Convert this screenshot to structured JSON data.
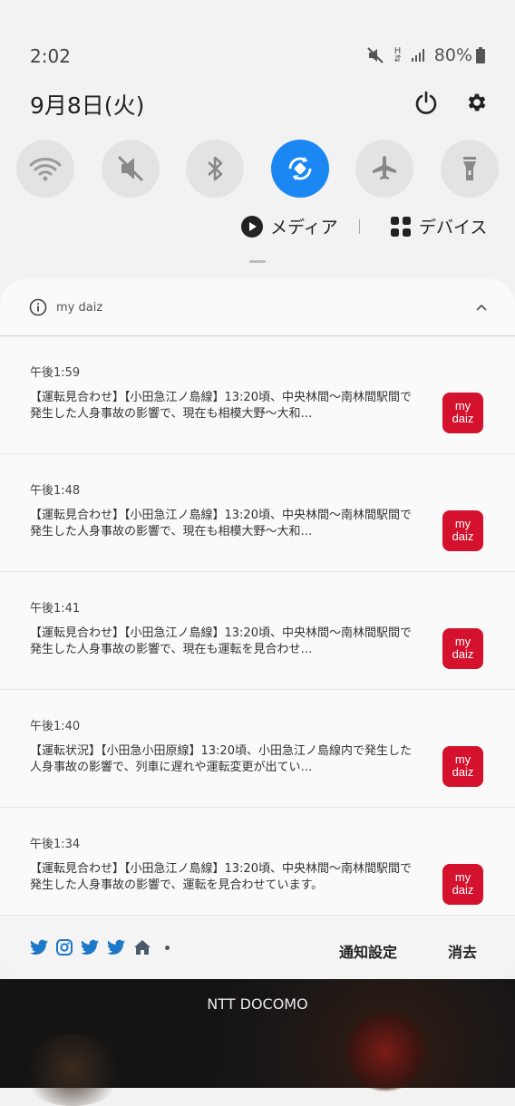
{
  "status_bar": {
    "time": "2:02",
    "battery": "80%",
    "network": "H"
  },
  "header": {
    "date": "9月8日(火)",
    "power_icon": "power-icon",
    "settings_icon": "gear-icon"
  },
  "quick_tiles": [
    {
      "icon": "wifi-icon",
      "active": false
    },
    {
      "icon": "sound-mute-icon",
      "active": false
    },
    {
      "icon": "bluetooth-icon",
      "active": false
    },
    {
      "icon": "auto-rotate-icon",
      "active": true
    },
    {
      "icon": "airplane-icon",
      "active": false
    },
    {
      "icon": "flashlight-icon",
      "active": false
    }
  ],
  "media": {
    "media_label": "メディア",
    "device_label": "デバイス"
  },
  "app_group": {
    "name": "my daiz"
  },
  "notifications": [
    {
      "time": "午後1:59",
      "text": "【運転見合わせ】【小田急江ノ島線】13:20頃、中央林間〜南林間駅間で発生した人身事故の影響で、現在も相模大野〜大和…",
      "logo_line1": "my",
      "logo_line2": "daiz"
    },
    {
      "time": "午後1:48",
      "text": "【運転見合わせ】【小田急江ノ島線】13:20頃、中央林間〜南林間駅間で発生した人身事故の影響で、現在も相模大野〜大和…",
      "logo_line1": "my",
      "logo_line2": "daiz"
    },
    {
      "time": "午後1:41",
      "text": "【運転見合わせ】【小田急江ノ島線】13:20頃、中央林間〜南林間駅間で発生した人身事故の影響で、現在も運転を見合わせ…",
      "logo_line1": "my",
      "logo_line2": "daiz"
    },
    {
      "time": "午後1:40",
      "text": "【運転状況】【小田急小田原線】13:20頃、小田急江ノ島線内で発生した人身事故の影響で、列車に遅れや運転変更が出てい…",
      "logo_line1": "my",
      "logo_line2": "daiz"
    },
    {
      "time": "午後1:34",
      "text": "【運転見合わせ】【小田急江ノ島線】13:20頃、中央林間〜南林間駅間で発生した人身事故の影響で、運転を見合わせています。",
      "logo_line1": "my",
      "logo_line2": "daiz"
    }
  ],
  "footer": {
    "settings_label": "通知設定",
    "clear_label": "消去"
  },
  "carrier": "NTT DOCOMO",
  "colors": {
    "accent": "#1a87f3",
    "logo_red": "#d4122e",
    "twitter_blue": "#1d78c8"
  }
}
